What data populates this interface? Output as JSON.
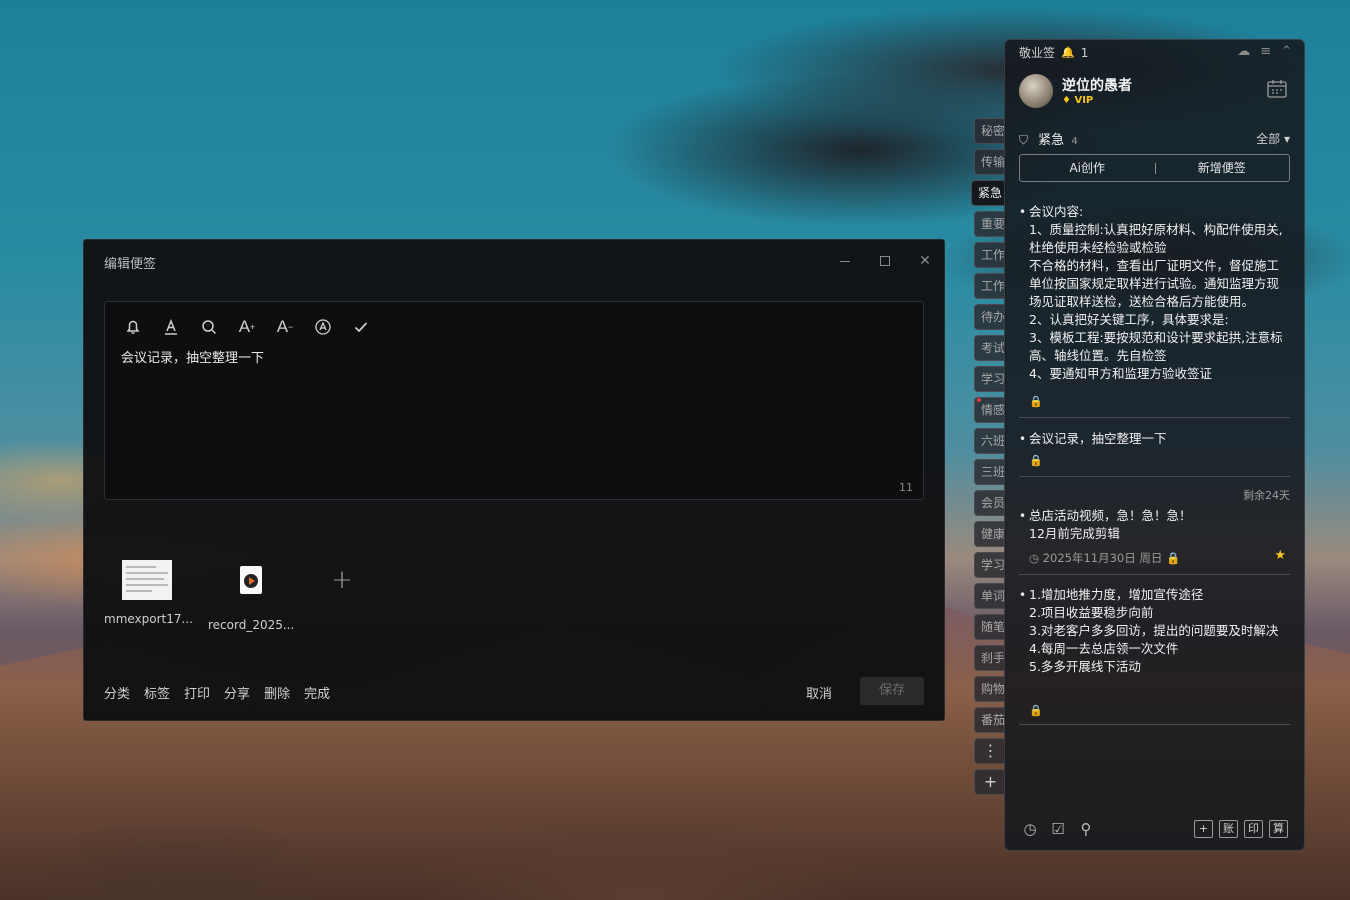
{
  "edit_window": {
    "title": "编辑便签",
    "toolbar": {
      "icons": [
        "bell-icon",
        "text-color-icon",
        "search-icon",
        "font-increase-icon",
        "font-decrease-icon",
        "ai-icon",
        "check-icon"
      ],
      "font_increase": "A",
      "font_decrease": "A"
    },
    "content": "会议记录，抽空整理一下",
    "char_count": "11",
    "attachments": [
      {
        "name": "mmexport17...",
        "type": "image"
      },
      {
        "name": "record_2025...",
        "type": "video"
      }
    ],
    "actions": [
      "分类",
      "标签",
      "打印",
      "分享",
      "删除",
      "完成"
    ],
    "cancel_label": "取消",
    "save_label": "保存"
  },
  "side_tabs": [
    "秘密",
    "传输",
    "紧急",
    "重要",
    "工作",
    "工作",
    "待办",
    "考试",
    "学习",
    "情感",
    "六班",
    "三班",
    "会员",
    "健康",
    "学习",
    "单词",
    "随笔",
    "刹手",
    "购物",
    "番茄"
  ],
  "active_tab": "紧急",
  "panel": {
    "app_name": "敬业签",
    "notification_count": "1",
    "user_name": "逆位的愚者",
    "vip_label": "VIP",
    "category": {
      "name": "紧急",
      "count": "4",
      "filter": "全部"
    },
    "ai_create_label": "Ai创作",
    "new_note_label": "新增便签",
    "notes": [
      {
        "lines": [
          "会议内容:",
          "1、质量控制:认真把好原材料、构配件使用关,杜绝使用未经检验或检验",
          "不合格的材料，查看出厂证明文件，督促施工单位按国家规定取样进行试验。通知监理方现场见证取样送检，送检合格后方能使用。",
          "2、认真把好关键工序，具体要求是:",
          "3、模板工程:要按规范和设计要求起拱,注意标高、轴线位置。先自检签",
          "4、要通知甲方和监理方验收签证"
        ]
      },
      {
        "lines": [
          "会议记录，抽空整理一下"
        ]
      },
      {
        "remaining": "剩余24天",
        "lines": [
          "总店活动视频，急！急！急！",
          "12月前完成剪辑"
        ],
        "due": "2025年11月30日 周日"
      },
      {
        "lines": [
          "1.增加地推力度，增加宣传途径",
          "2.项目收益要稳步向前",
          "3.对老客户多多回访，提出的问题要及时解决",
          "4.每周一去总店领一次文件",
          "5.多多开展线下活动"
        ]
      }
    ],
    "footer_right": [
      "+",
      "账",
      "印",
      "算"
    ]
  }
}
